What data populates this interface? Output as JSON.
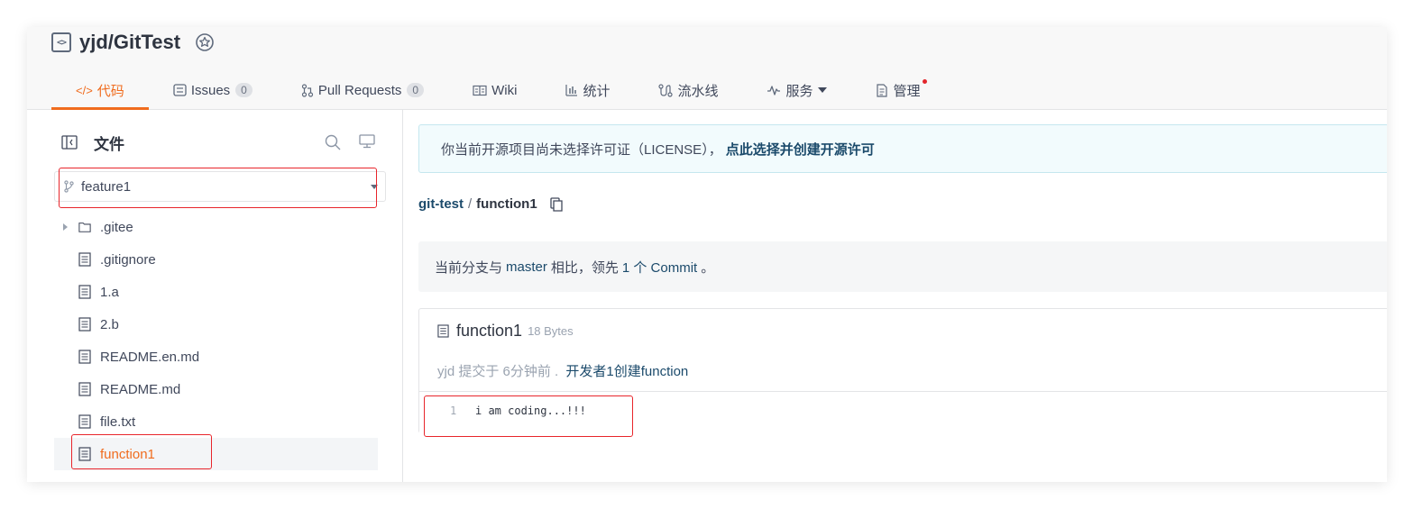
{
  "repo": {
    "name": "yjd/GitTest"
  },
  "tabs": [
    {
      "label": "代码",
      "icon": "code-icon",
      "active": true
    },
    {
      "label": "Issues",
      "icon": "issues-icon",
      "count": "0"
    },
    {
      "label": "Pull Requests",
      "icon": "pull-request-icon",
      "count": "0"
    },
    {
      "label": "Wiki",
      "icon": "book-icon"
    },
    {
      "label": "统计",
      "icon": "bar-chart-icon"
    },
    {
      "label": "流水线",
      "icon": "pipeline-icon"
    },
    {
      "label": "服务",
      "icon": "pulse-icon"
    },
    {
      "label": "管理",
      "icon": "manage-icon"
    }
  ],
  "sidebar": {
    "title": "文件",
    "branch": "feature1",
    "files": [
      ".gitee",
      ".gitignore",
      "1.a",
      "2.b",
      "README.en.md",
      "README.md",
      "file.txt",
      "function1"
    ]
  },
  "license_notice": {
    "text": "你当前开源项目尚未选择许可证（LICENSE），",
    "link": "点此选择并创建开源许可"
  },
  "breadcrumb": {
    "repo": "git-test",
    "separator": "/",
    "current": "function1"
  },
  "compare": {
    "prefix": "当前分支与",
    "branch": "master",
    "middle": "相比，领先",
    "commits": "1 个 Commit",
    "suffix": "。"
  },
  "file_view": {
    "name": "function1",
    "size": "18 Bytes",
    "commit_info": "yjd 提交于 6分钟前 .",
    "commit_message": "开发者1创建function",
    "line_number": "1",
    "code_line": "i am coding...!!!"
  },
  "colors": {
    "accent": "#f06c1e",
    "link": "#1b4a6b",
    "highlight": "#e8252b",
    "notification": "#e3262c"
  }
}
